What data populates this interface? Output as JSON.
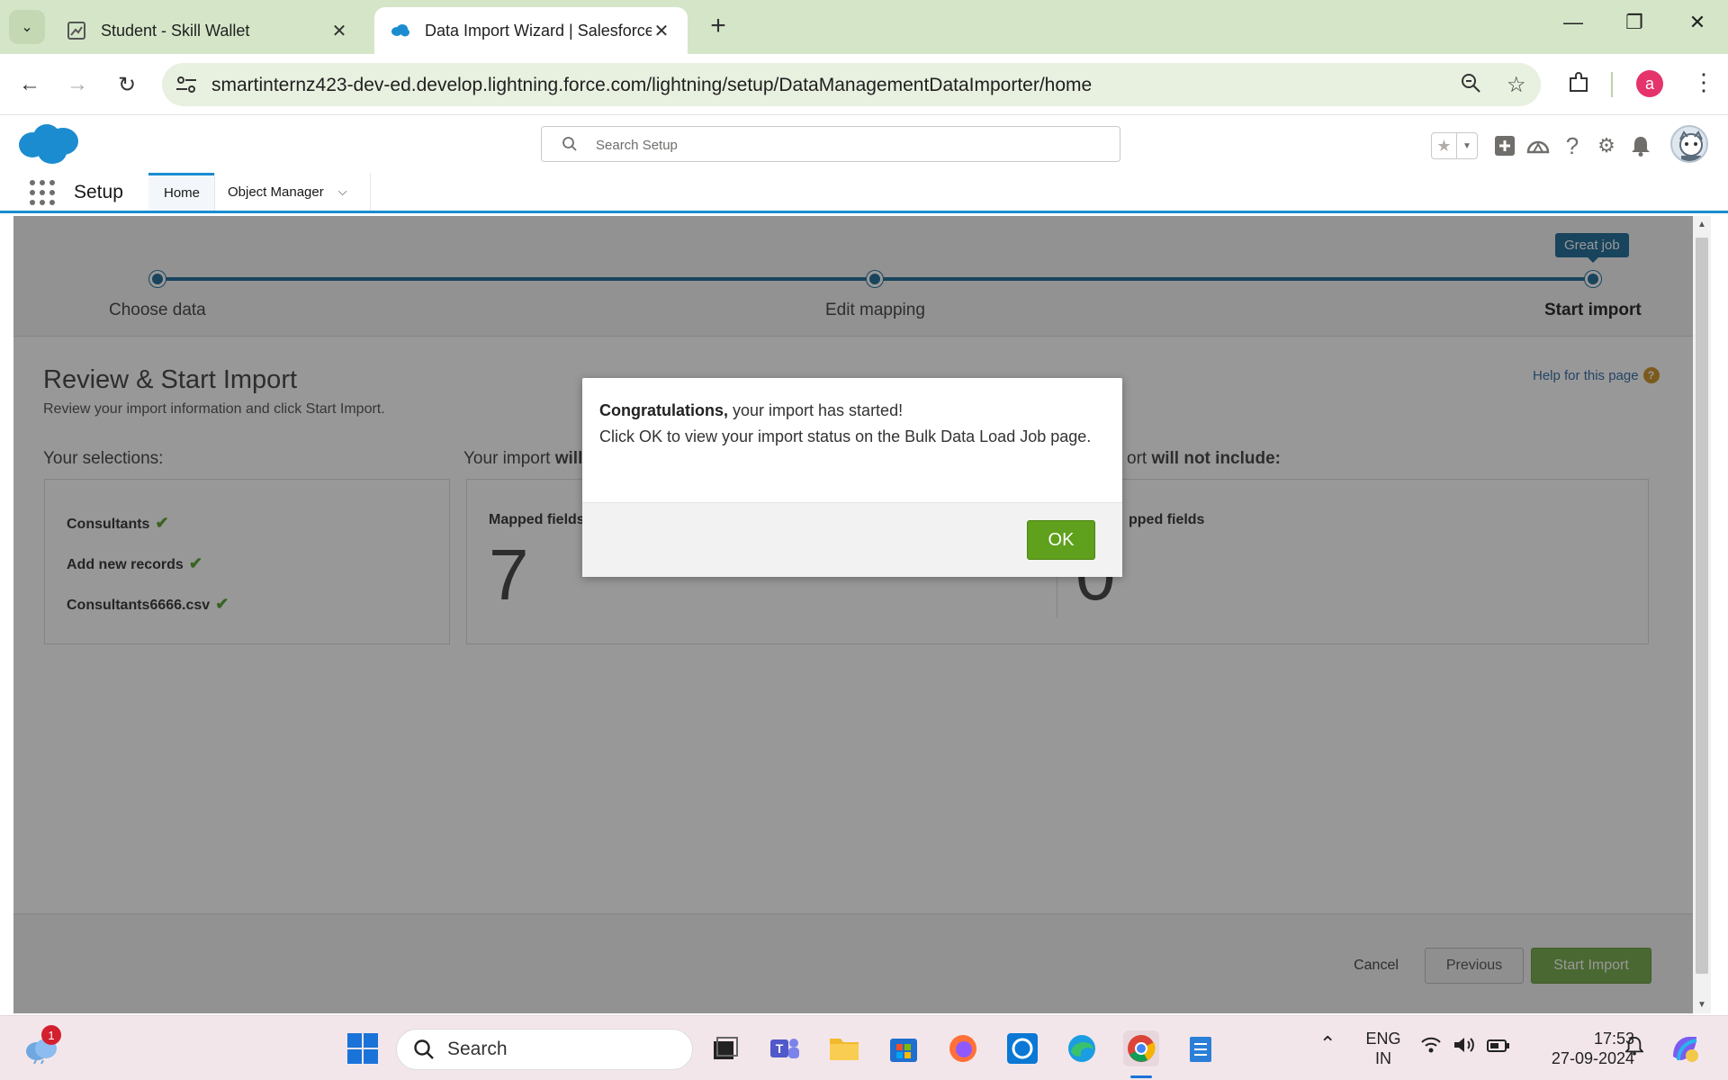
{
  "browser": {
    "tabs": [
      {
        "title": "Student - Skill Wallet",
        "active": false
      },
      {
        "title": "Data Import Wizard | Salesforce",
        "active": true
      }
    ],
    "new_tab_symbol": "+",
    "url": "smartinternz423-dev-ed.develop.lightning.force.com/lightning/setup/DataManagementDataImporter/home",
    "profile_initial": "a"
  },
  "salesforce": {
    "search_placeholder": "Search Setup",
    "app_name": "Setup",
    "nav_tabs": [
      "Home",
      "Object Manager"
    ],
    "brand_color": "#1b8cd0"
  },
  "wizard": {
    "steps": [
      "Choose data",
      "Edit mapping",
      "Start import"
    ],
    "current_step": 3,
    "tooltip": "Great job",
    "title": "Review & Start Import",
    "subtitle": "Review your import information and click Start Import.",
    "help_link": "Help for this page",
    "selections_label": "Your selections:",
    "selections": [
      "Consultants",
      "Add new records",
      "Consultants6666.csv"
    ],
    "will_include_label_prefix": "Your import ",
    "will_include_label_bold": "will",
    "will_not_include_label_prefix": "ort ",
    "will_not_include_label_bold": "will not include:",
    "mapped_fields_label": "Mapped fields",
    "mapped_fields_count": "7",
    "unmapped_fields_label": "pped fields",
    "unmapped_fields_count": "0",
    "buttons": {
      "cancel": "Cancel",
      "previous": "Previous",
      "start": "Start Import"
    }
  },
  "modal": {
    "heading_bold": "Congratulations,",
    "heading_rest": " your import has started!",
    "message": "Click OK to view your import status on the Bulk Data Load Job page.",
    "ok_label": "OK"
  },
  "taskbar": {
    "notification_count": "1",
    "search_label": "Search",
    "language": "ENG",
    "region": "IN",
    "time": "17:53",
    "date": "27-09-2024"
  },
  "colors": {
    "progress_track": "#0b5e8f",
    "ok_button": "#5fa01c",
    "start_button": "#6aa33b"
  }
}
